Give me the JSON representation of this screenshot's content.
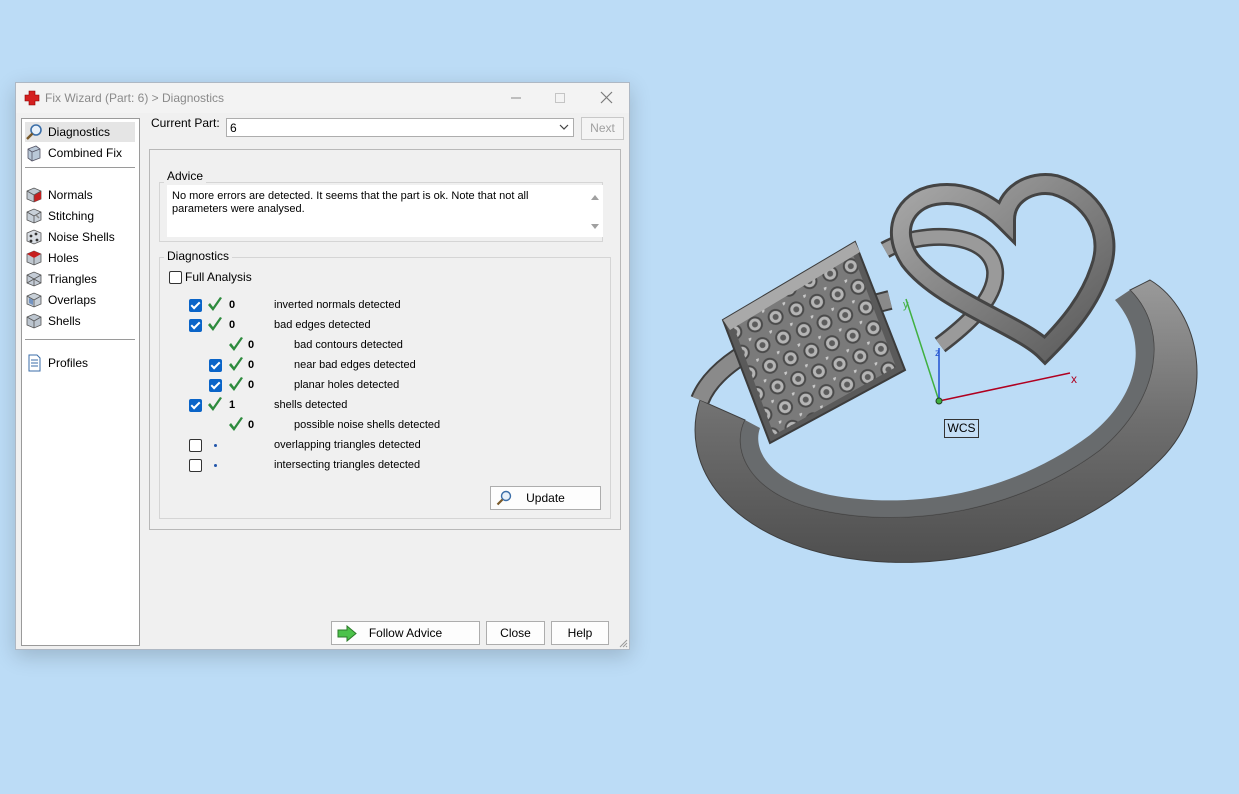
{
  "window": {
    "title": "Fix Wizard (Part: 6) > Diagnostics",
    "controls": {
      "minimize_icon": "minimize-icon",
      "maximize_icon": "maximize-icon",
      "close_icon": "close-icon"
    }
  },
  "sidebar": {
    "items": [
      {
        "label": "Diagnostics",
        "icon": "magnifier-icon",
        "selected": true
      },
      {
        "label": "Combined Fix",
        "icon": "combined-fix-icon"
      },
      {
        "label": "Normals",
        "icon": "normals-icon"
      },
      {
        "label": "Stitching",
        "icon": "stitching-icon"
      },
      {
        "label": "Noise Shells",
        "icon": "noise-shells-icon"
      },
      {
        "label": "Holes",
        "icon": "holes-icon"
      },
      {
        "label": "Triangles",
        "icon": "triangles-icon"
      },
      {
        "label": "Overlaps",
        "icon": "overlaps-icon"
      },
      {
        "label": "Shells",
        "icon": "shells-icon"
      },
      {
        "label": "Profiles",
        "icon": "profiles-icon"
      }
    ]
  },
  "current_part": {
    "label": "Current Part:",
    "value": "6",
    "next_label": "Next"
  },
  "advice": {
    "legend": "Advice",
    "text": "No more errors are detected. It seems that the part is ok. Note that not all parameters were analysed."
  },
  "diagnostics": {
    "legend": "Diagnostics",
    "full_analysis_label": "Full Analysis",
    "full_analysis_checked": false,
    "rows": [
      {
        "checked": true,
        "status": "ok",
        "count": "0",
        "label": "inverted normals detected",
        "indent": 0
      },
      {
        "checked": true,
        "status": "ok",
        "count": "0",
        "label": "bad edges detected",
        "indent": 0
      },
      {
        "checked": null,
        "status": "ok",
        "count": "0",
        "label": "bad contours detected",
        "indent": 1
      },
      {
        "checked": true,
        "status": "ok",
        "count": "0",
        "label": "near bad edges detected",
        "indent": 1
      },
      {
        "checked": true,
        "status": "ok",
        "count": "0",
        "label": "planar holes detected",
        "indent": 1
      },
      {
        "checked": true,
        "status": "ok",
        "count": "1",
        "label": "shells detected",
        "indent": 0
      },
      {
        "checked": null,
        "status": "ok",
        "count": "0",
        "label": "possible noise shells detected",
        "indent": 1
      },
      {
        "checked": false,
        "status": "pending",
        "count": "",
        "label": "overlapping triangles detected",
        "indent": 0
      },
      {
        "checked": false,
        "status": "pending",
        "count": "",
        "label": "intersecting triangles detected",
        "indent": 0
      }
    ],
    "update_label": "Update"
  },
  "footer": {
    "follow_advice_label": "Follow Advice",
    "close_label": "Close",
    "help_label": "Help"
  },
  "viewport": {
    "axis_labels": {
      "x": "x",
      "y": "y",
      "z": "z"
    },
    "wcs_label": "WCS"
  },
  "colors": {
    "background": "#bcdcf6",
    "check_green": "#2e8b3e",
    "checkbox_blue": "#0a64c8",
    "x_axis": "#b00020",
    "y_axis": "#40b040",
    "z_axis": "#2050d0"
  }
}
